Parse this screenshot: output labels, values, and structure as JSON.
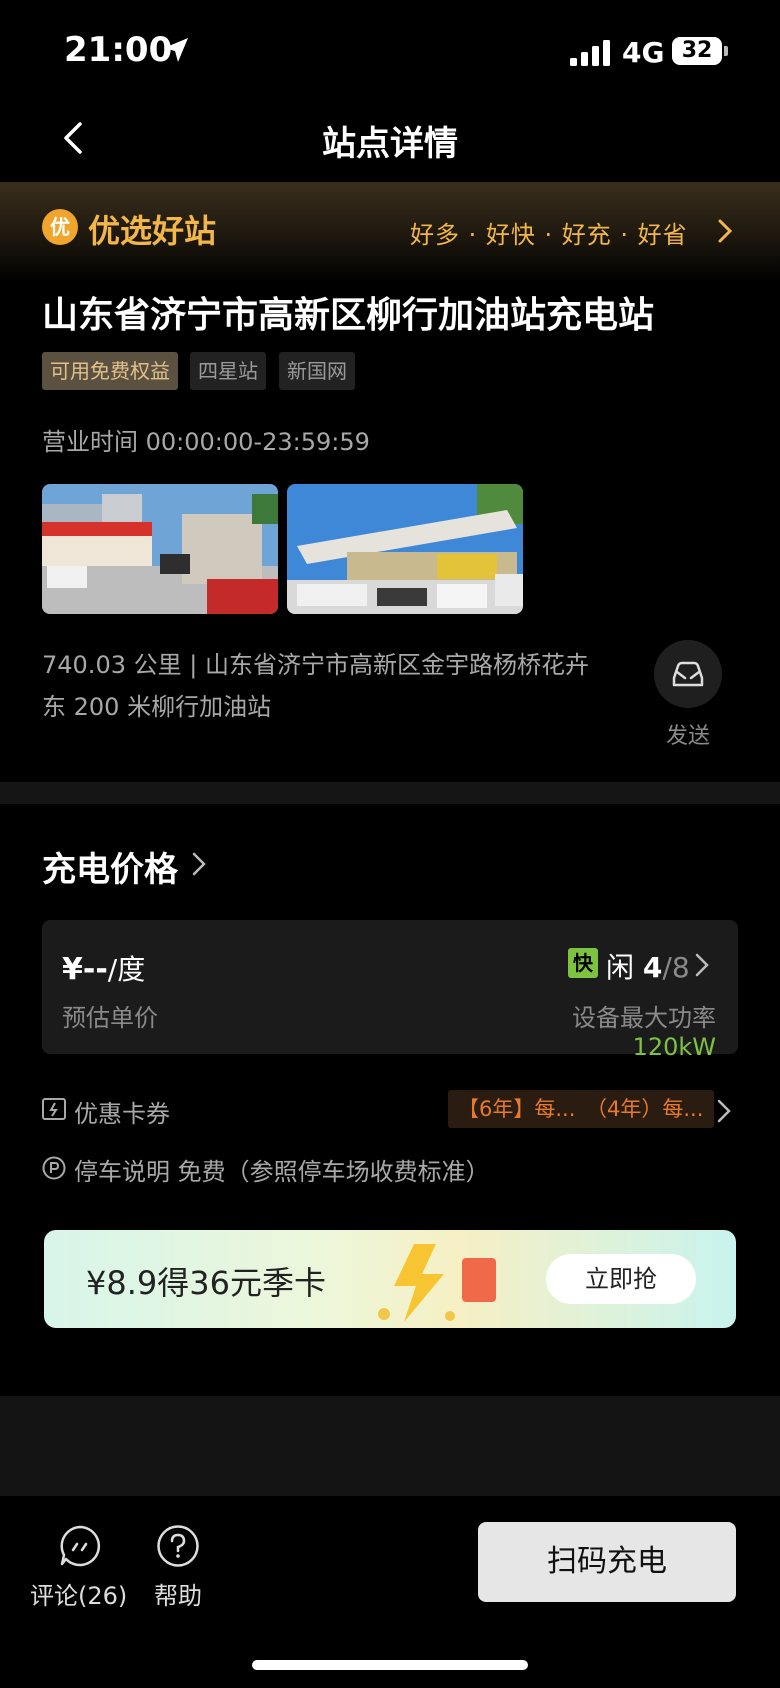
{
  "status_bar": {
    "time": "21:00",
    "network": "4G",
    "battery": "32"
  },
  "nav": {
    "title": "站点详情"
  },
  "promo_band": {
    "badge": "优",
    "title": "优选好站",
    "slogan": "好多 · 好快 · 好充 · 好省"
  },
  "station": {
    "name": "山东省济宁市高新区柳行加油站充电站",
    "tags": [
      "可用免费权益",
      "四星站",
      "新国网"
    ],
    "hours": "营业时间 00:00:00-23:59:59",
    "address": "740.03 公里 | 山东省济宁市高新区金宇路杨桥花卉东 200 米柳行加油站",
    "send_label": "发送"
  },
  "price": {
    "section_title": "充电价格",
    "value": "¥--",
    "unit": "/度",
    "subtitle": "预估单价",
    "fast_badge": "快",
    "idle_label": "闲",
    "idle_available": "4",
    "idle_total": "/8",
    "power_label": "设备最大功率",
    "power_value": "120kW"
  },
  "coupons": {
    "label": "优惠卡券",
    "items": [
      "【6年】每...",
      "（4年）每..."
    ]
  },
  "parking": {
    "label": "停车说明 免费（参照停车场收费标准）"
  },
  "banner": {
    "text": "¥8.9得36元季卡",
    "button": "立即抢"
  },
  "bottom_bar": {
    "comment_label": "评论(26)",
    "help_label": "帮助",
    "scan_button": "扫码充电"
  },
  "colors": {
    "gold": "#f2b64a",
    "green": "#7ec242",
    "orange": "#e87a2c"
  }
}
